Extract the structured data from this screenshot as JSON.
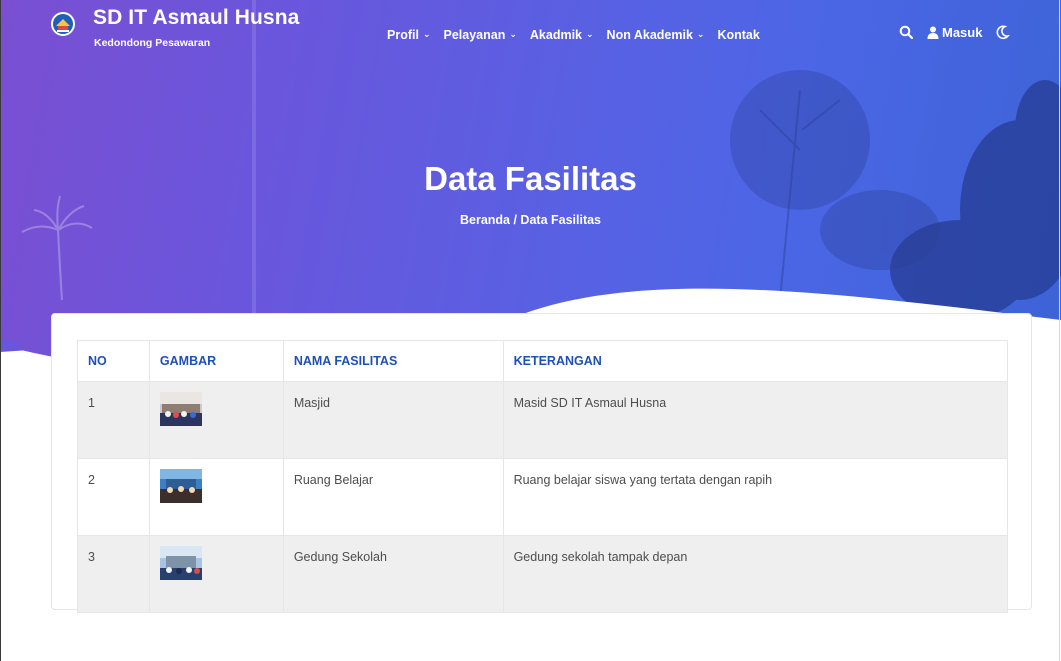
{
  "brand": {
    "title": "SD IT Asmaul Husna",
    "subtitle": "Kedondong Pesawaran"
  },
  "nav": {
    "items": [
      {
        "label": "Profil",
        "has_dropdown": true
      },
      {
        "label": "Pelayanan",
        "has_dropdown": true
      },
      {
        "label": "Akadmik",
        "has_dropdown": true
      },
      {
        "label": "Non Akademik",
        "has_dropdown": true
      },
      {
        "label": "Kontak",
        "has_dropdown": false
      }
    ],
    "login_label": "Masuk",
    "icons": [
      "search-icon",
      "user-icon",
      "dark-mode-moon-icon",
      "chevron-down-icon"
    ]
  },
  "hero": {
    "title": "Data Fasilitas",
    "breadcrumb": "Beranda / Data Fasilitas"
  },
  "table": {
    "headers": [
      "NO",
      "GAMBAR",
      "NAMA FASILITAS",
      "KETERANGAN"
    ],
    "rows": [
      {
        "no": "1",
        "nama": "Masjid",
        "keterangan": "Masid SD IT Asmaul Husna"
      },
      {
        "no": "2",
        "nama": "Ruang Belajar",
        "keterangan": "Ruang belajar siswa yang tertata dengan rapih"
      },
      {
        "no": "3",
        "nama": "Gedung Sekolah",
        "keterangan": "Gedung sekolah tampak depan"
      }
    ]
  },
  "colors": {
    "hero_start": "#7a4fd2",
    "hero_end": "#3c63d6",
    "table_header_text": "#1f4fb8",
    "row_stripe": "#efefef"
  }
}
